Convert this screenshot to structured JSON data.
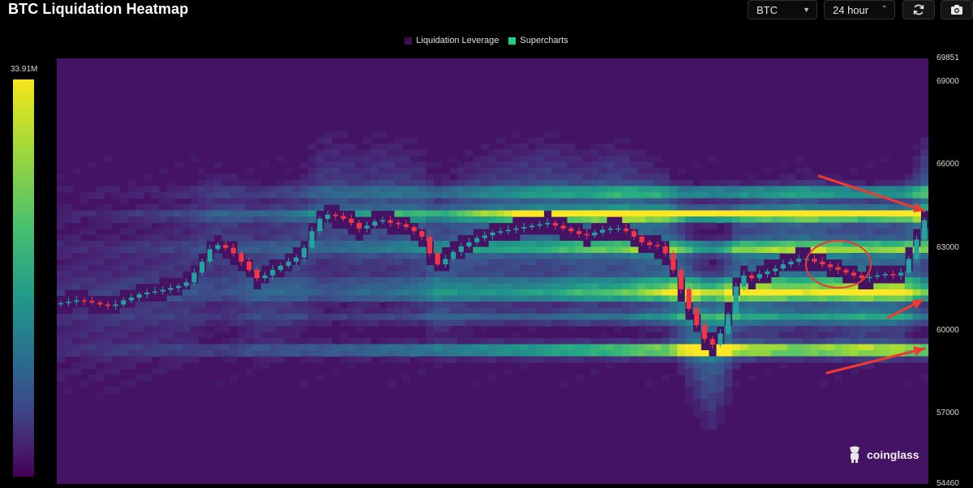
{
  "header": {
    "title": "BTC Liquidation Heatmap",
    "symbol_select": {
      "value": "BTC"
    },
    "range_select": {
      "value": "24 hour"
    },
    "refresh_icon": "refresh-icon",
    "camera_icon": "camera-icon"
  },
  "legend": {
    "items": [
      {
        "label": "Liquidation Leverage",
        "color": "#3b0f4f"
      },
      {
        "label": "Supercharts",
        "color": "#1fd17e"
      }
    ]
  },
  "colorbar": {
    "max_label": "33.91M"
  },
  "watermark": {
    "text": "coinglass"
  },
  "colors": {
    "up": "#22a39f",
    "down": "#f23645",
    "low": "#440154",
    "high": "#f4e61a",
    "annotation": "#ef3b2f"
  },
  "chart_data": {
    "type": "heatmap",
    "title": "BTC Liquidation Heatmap",
    "xlabel": "",
    "ylabel": "",
    "ylim": [
      54460,
      69851
    ],
    "y_ticks": [
      54460,
      57000,
      60000,
      63000,
      66000,
      69000,
      69851
    ],
    "color_range": [
      "0",
      "33.91M"
    ],
    "legend_position": "top-center",
    "grid": false,
    "price_path": [
      61000,
      61050,
      61100,
      61080,
      61020,
      60950,
      60900,
      60950,
      61100,
      61200,
      61320,
      61380,
      61420,
      61480,
      61550,
      61620,
      61750,
      62100,
      62500,
      62950,
      63100,
      63000,
      62800,
      62500,
      62200,
      61900,
      62000,
      62200,
      62350,
      62500,
      62650,
      63000,
      63600,
      64050,
      64200,
      64150,
      64050,
      63900,
      63700,
      63800,
      63950,
      64000,
      63900,
      63850,
      63750,
      63600,
      63400,
      62800,
      62400,
      62600,
      62850,
      63050,
      63200,
      63350,
      63450,
      63550,
      63600,
      63650,
      63700,
      63750,
      63800,
      63850,
      63900,
      63800,
      63700,
      63600,
      63500,
      63450,
      63550,
      63650,
      63700,
      63700,
      63600,
      63400,
      63200,
      63100,
      63050,
      62800,
      62200,
      61500,
      60800,
      60200,
      59700,
      59500,
      59900,
      60600,
      61600,
      62000,
      61900,
      62050,
      62150,
      62250,
      62400,
      62500,
      62600,
      62600,
      62500,
      62400,
      62300,
      62200,
      62100,
      62000,
      61900,
      61950,
      62000,
      62050,
      62000,
      62100,
      62600,
      63300,
      64000
    ],
    "heat_bands": [
      {
        "price": 64200,
        "intensity": 1.0
      },
      {
        "price": 59300,
        "intensity": 0.95
      },
      {
        "price": 61300,
        "intensity": 0.7
      },
      {
        "price": 63000,
        "intensity": 0.6
      },
      {
        "price": 65000,
        "intensity": 0.55
      },
      {
        "price": 61700,
        "intensity": 0.45
      },
      {
        "price": 60500,
        "intensity": 0.4
      }
    ]
  }
}
